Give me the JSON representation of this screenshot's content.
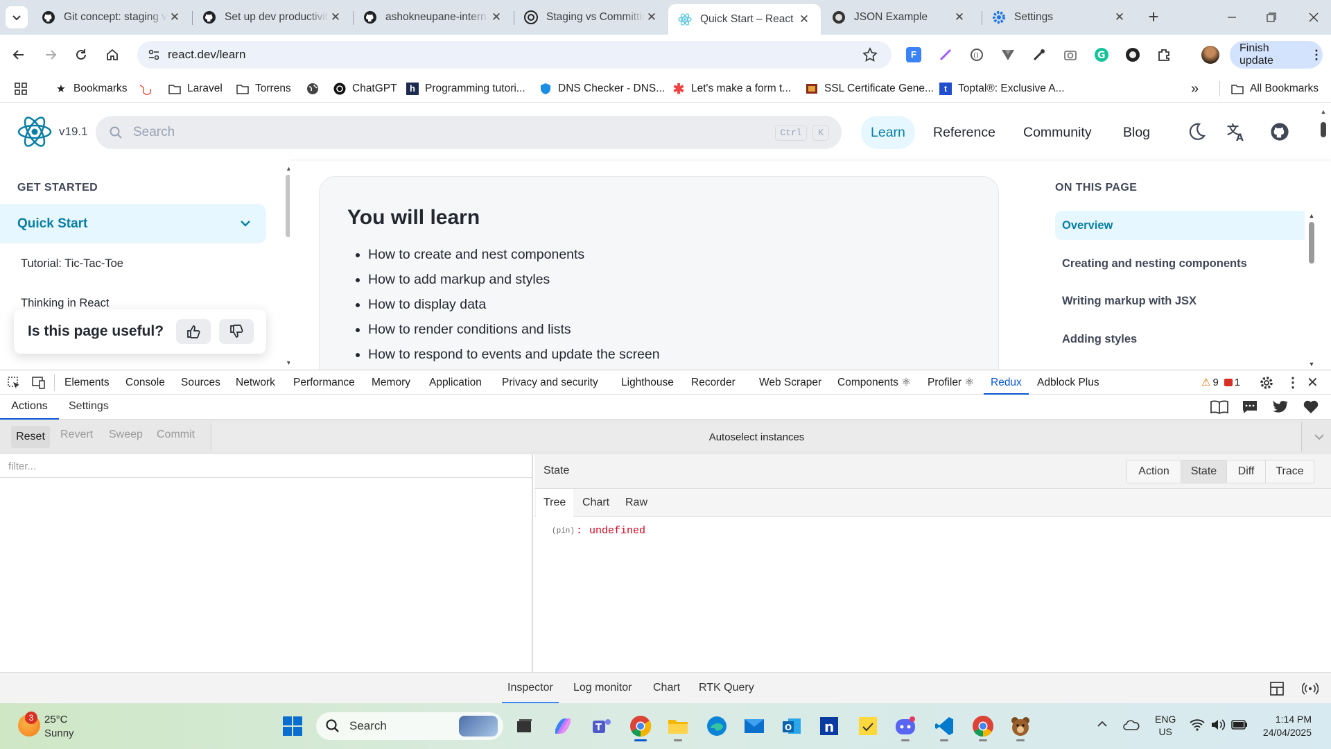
{
  "browser": {
    "tabs": [
      {
        "title": "Git concept: staging vs",
        "icon": "github-icon"
      },
      {
        "title": "Set up dev productivity",
        "icon": "github-icon"
      },
      {
        "title": "ashokneupane-intern",
        "icon": "github-icon"
      },
      {
        "title": "Staging vs Committing",
        "icon": "openai-icon"
      },
      {
        "title": "Quick Start – React",
        "icon": "react-icon",
        "active": true
      },
      {
        "title": "JSON Example",
        "icon": "globe-icon"
      },
      {
        "title": "Settings",
        "icon": "gear-icon"
      }
    ],
    "new_tab": "+",
    "url": "react.dev/learn",
    "finish_update": "Finish update",
    "bookmarks": [
      {
        "label": "Bookmarks",
        "icon": "star-icon"
      },
      {
        "label": "",
        "icon": "laravel-icon"
      },
      {
        "label": "Laravel",
        "icon": "folder-icon"
      },
      {
        "label": "Torrens",
        "icon": "folder-icon"
      },
      {
        "label": "",
        "icon": "globe-icon"
      },
      {
        "label": "ChatGPT",
        "icon": "openai-icon"
      },
      {
        "label": "Programming tutori...",
        "icon": "hashnode-icon"
      },
      {
        "label": "DNS Checker - DNS...",
        "icon": "shield-icon"
      },
      {
        "label": "Let's make a form t...",
        "icon": "asterisk-icon"
      },
      {
        "label": "SSL Certificate Gene...",
        "icon": "certificate-icon"
      },
      {
        "label": "Toptal®: Exclusive A...",
        "icon": "toptal-icon"
      }
    ],
    "all_bookmarks": "All Bookmarks"
  },
  "site": {
    "version": "v19.1",
    "search_placeholder": "Search",
    "kbd_ctrl": "Ctrl",
    "kbd_k": "K",
    "nav": [
      "Learn",
      "Reference",
      "Community",
      "Blog"
    ],
    "sidebar": {
      "heading": "GET STARTED",
      "active": "Quick Start",
      "items": [
        "Tutorial: Tic-Tac-Toe",
        "Thinking in React"
      ]
    },
    "feedback": "Is this page useful?",
    "main": {
      "heading": "You will learn",
      "items": [
        "How to create and nest components",
        "How to add markup and styles",
        "How to display data",
        "How to render conditions and lists",
        "How to respond to events and update the screen"
      ]
    },
    "toc": {
      "heading": "ON THIS PAGE",
      "active": "Overview",
      "items": [
        "Creating and nesting components",
        "Writing markup with JSX",
        "Adding styles"
      ]
    }
  },
  "devtools": {
    "tabs": [
      "Elements",
      "Console",
      "Sources",
      "Network",
      "Performance",
      "Memory",
      "Application",
      "Privacy and security",
      "Lighthouse",
      "Recorder",
      "Web Scraper",
      "Components ⚛",
      "Profiler ⚛",
      "Redux",
      "Adblock Plus"
    ],
    "active_tab": "Redux",
    "warnings": "9",
    "errors": "1",
    "subtabs": [
      "Actions",
      "Settings"
    ],
    "actions": [
      "Reset",
      "Revert",
      "Sweep",
      "Commit"
    ],
    "autoselect": "Autoselect instances",
    "filter_placeholder": "filter...",
    "state_label": "State",
    "state_buttons": [
      "Action",
      "State",
      "Diff",
      "Trace"
    ],
    "active_state_button": "State",
    "views": [
      "Tree",
      "Chart",
      "Raw"
    ],
    "active_view": "Tree",
    "tree": {
      "key": "(pin)",
      "sep": ":",
      "value": "undefined"
    },
    "bottom_tabs": [
      "Inspector",
      "Log monitor",
      "Chart",
      "RTK Query"
    ],
    "active_bottom": "Inspector"
  },
  "taskbar": {
    "weather_temp": "25°C",
    "weather_desc": "Sunny",
    "weather_badge": "3",
    "search": "Search",
    "lang1": "ENG",
    "lang2": "US",
    "time": "1:14 PM",
    "date": "24/04/2025"
  },
  "colors": {
    "react_blue": "#087ea4",
    "chrome_tabstrip": "#dde3ea",
    "devtools_active": "#0b57d0",
    "tree_value": "#d0021b"
  }
}
